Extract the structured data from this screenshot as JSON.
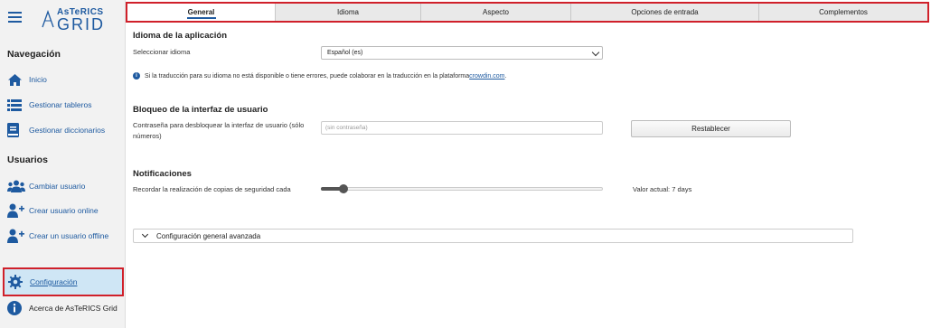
{
  "sidebar": {
    "logo_top": "AsTeRICS",
    "logo_bottom": "GRID",
    "nav_title": "Navegación",
    "nav_items": [
      {
        "label": "Inicio",
        "icon": "home-icon"
      },
      {
        "label": "Gestionar tableros",
        "icon": "list-icon"
      },
      {
        "label": "Gestionar diccionarios",
        "icon": "book-icon"
      }
    ],
    "users_title": "Usuarios",
    "user_items": [
      {
        "label": "Cambiar usuario",
        "icon": "users-icon"
      },
      {
        "label": "Crear usuario online",
        "icon": "user-plus-icon"
      },
      {
        "label": "Crear un usuario offline",
        "icon": "user-plus-icon"
      }
    ],
    "config_label": "Configuración",
    "about_label": "Acerca de AsTeRICS Grid"
  },
  "tabs": [
    {
      "label": "General",
      "active": true
    },
    {
      "label": "Idioma",
      "active": false
    },
    {
      "label": "Aspecto",
      "active": false
    },
    {
      "label": "Opciones de entrada",
      "active": false
    },
    {
      "label": "Complementos",
      "active": false
    }
  ],
  "language": {
    "heading": "Idioma de la aplicación",
    "select_label": "Seleccionar idioma",
    "selected_value": "Español (es)",
    "info_text": "Si la traducción para su idioma no está disponible o tiene errores, puede colaborar en la traducción en la plataforma ",
    "info_link": "crowdin.com",
    "info_end": "."
  },
  "unlock": {
    "heading": "Bloqueo de la interfaz de usuario",
    "password_label": "Contraseña para desbloquear la interfaz de usuario (sólo números)",
    "password_placeholder": "(sin contraseña)",
    "reset_label": "Restablecer"
  },
  "notifications": {
    "heading": "Notificaciones",
    "backup_label": "Recordar la realización de copias de seguridad cada",
    "slider_fraction": 0.08,
    "current_value": "Valor actual: 7 days"
  },
  "advanced": {
    "label": "Configuración general avanzada"
  },
  "colors": {
    "accent": "#1e5aa0",
    "highlight_border": "#d0202a",
    "active_nav_bg": "#cfe6f5"
  }
}
